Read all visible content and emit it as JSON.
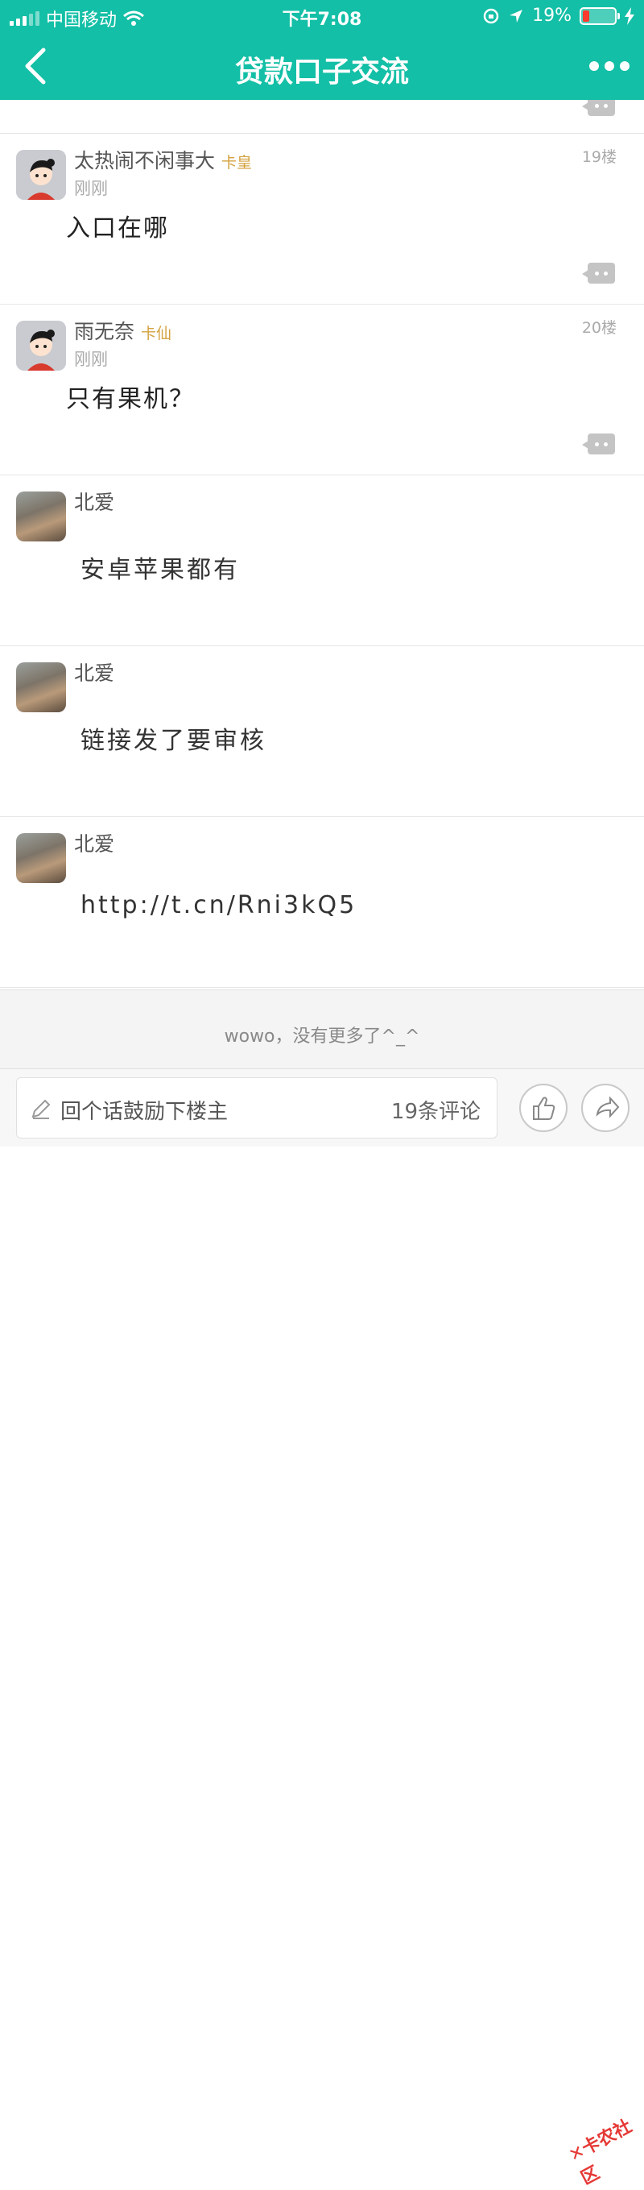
{
  "status": {
    "carrier": "中国移动",
    "time": "下午7:08",
    "battery": "19%"
  },
  "nav": {
    "title": "贷款口子交流"
  },
  "posts": [
    {
      "user": "太热闹不闲事大",
      "badge": "卡皇",
      "time": "刚刚",
      "floor": "19楼",
      "body": "入口在哪"
    },
    {
      "user": "雨无奈",
      "badge": "卡仙",
      "time": "刚刚",
      "floor": "20楼",
      "body": "只有果机？"
    }
  ],
  "replies": [
    {
      "user": "北爱",
      "body": "安卓苹果都有"
    },
    {
      "user": "北爱",
      "body": "链接发了要审核"
    },
    {
      "user": "北爱",
      "body": "http://t.cn/Rni3kQ5"
    }
  ],
  "footer": {
    "end_text": "wowo，没有更多了^_^"
  },
  "bottom": {
    "input_placeholder": "回个话鼓励下楼主",
    "comment_count": "19条评论"
  },
  "watermark": "卡农社区",
  "colors": {
    "primary": "#13bfa6",
    "badge": "#d4a23f"
  }
}
